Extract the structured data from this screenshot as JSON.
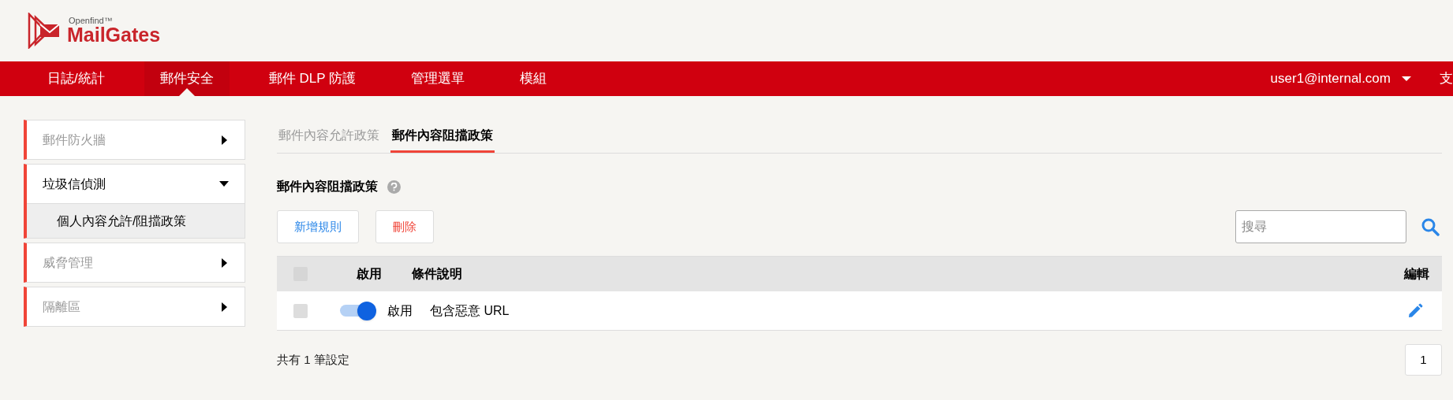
{
  "logo": {
    "tagline": "Openfind™",
    "name": "MailGates"
  },
  "nav": {
    "items": [
      {
        "label": "日誌/統計",
        "selected": false
      },
      {
        "label": "郵件安全",
        "selected": true
      },
      {
        "label": "郵件 DLP 防護",
        "selected": false
      },
      {
        "label": "管理選單",
        "selected": false
      },
      {
        "label": "模組",
        "selected": false
      }
    ],
    "user": "user1@internal.com",
    "cut_item": "支"
  },
  "sidebar": {
    "items": [
      {
        "label": "郵件防火牆",
        "expanded": false
      },
      {
        "label": "垃圾信偵測",
        "expanded": true,
        "children": [
          {
            "label": "個人內容允許/阻擋政策",
            "selected": true
          }
        ]
      },
      {
        "label": "威脅管理",
        "expanded": false
      },
      {
        "label": "隔離區",
        "expanded": false
      }
    ]
  },
  "tabs": [
    {
      "label": "郵件內容允許政策",
      "selected": false
    },
    {
      "label": "郵件內容阻擋政策",
      "selected": true
    }
  ],
  "section_title": "郵件內容阻擋政策",
  "buttons": [
    {
      "label": "新增規則",
      "kind": "add"
    },
    {
      "label": "刪除",
      "kind": "delete"
    }
  ],
  "search": {
    "placeholder": "搜尋"
  },
  "table": {
    "all_checked": false,
    "columns": [
      "啟用",
      "條件說明",
      "編輯"
    ],
    "rows": [
      {
        "checked": false,
        "on": true,
        "status": "啟用",
        "description": "包含惡意 URL"
      }
    ]
  },
  "footer": {
    "summary": "共有 1 筆設定",
    "pages": [
      {
        "label": "1",
        "selected": false
      }
    ]
  }
}
